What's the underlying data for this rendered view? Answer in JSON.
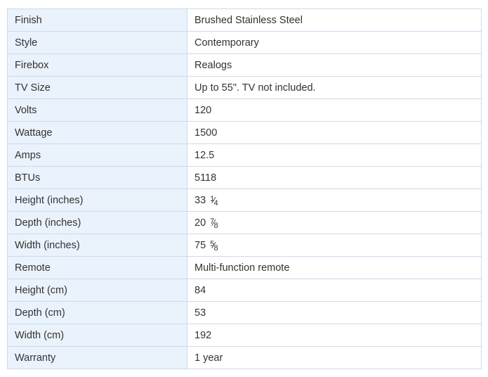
{
  "specs": [
    {
      "label": "Finish",
      "value": "Brushed Stainless Steel"
    },
    {
      "label": "Style",
      "value": "Contemporary"
    },
    {
      "label": "Firebox",
      "value": "Realogs"
    },
    {
      "label": "TV Size",
      "value": "Up to 55\". TV not included."
    },
    {
      "label": "Volts",
      "value": "120"
    },
    {
      "label": "Wattage",
      "value": "1500"
    },
    {
      "label": "Amps",
      "value": "12.5"
    },
    {
      "label": "BTUs",
      "value": "5118"
    },
    {
      "label": "Height (inches)",
      "value": "33",
      "frac_num": "1",
      "frac_den": "4"
    },
    {
      "label": "Depth (inches)",
      "value": "20",
      "frac_num": "7",
      "frac_den": "8"
    },
    {
      "label": "Width (inches)",
      "value": "75",
      "frac_num": "5",
      "frac_den": "8"
    },
    {
      "label": "Remote",
      "value": "Multi-function remote"
    },
    {
      "label": "Height (cm)",
      "value": "84"
    },
    {
      "label": "Depth (cm)",
      "value": "53"
    },
    {
      "label": "Width (cm)",
      "value": "192"
    },
    {
      "label": "Warranty",
      "value": "1 year"
    }
  ]
}
